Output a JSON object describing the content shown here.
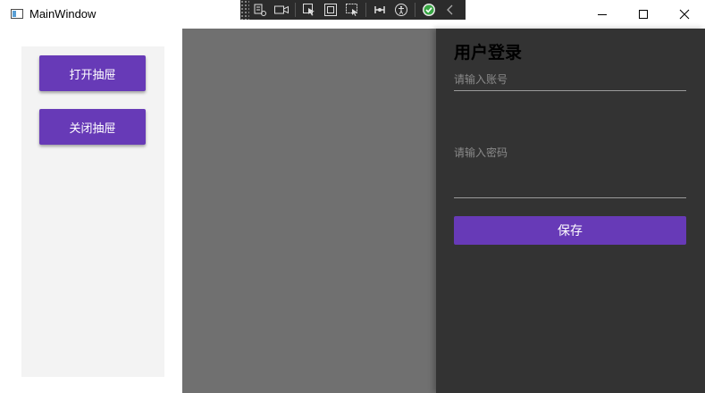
{
  "window": {
    "title": "MainWindow"
  },
  "debug_toolbar": {
    "items": [
      "select-element-icon",
      "track-focus-icon",
      "display-layout-adorners-icon",
      "hot-reload-icon",
      "accessibility-icon",
      "status-ok-icon",
      "collapse-icon"
    ]
  },
  "left_panel": {
    "open_drawer_label": "打开抽屉",
    "close_drawer_label": "关闭抽屉"
  },
  "drawer": {
    "title": "用户登录",
    "account_placeholder": "请输入账号",
    "account_value": "",
    "password_placeholder": "请输入密码",
    "password_value": "",
    "save_label": "保存"
  },
  "colors": {
    "accent": "#673ab7",
    "drawer_bg": "#333333",
    "overlay": "#707070",
    "panel_bg": "#f3f3f3"
  }
}
